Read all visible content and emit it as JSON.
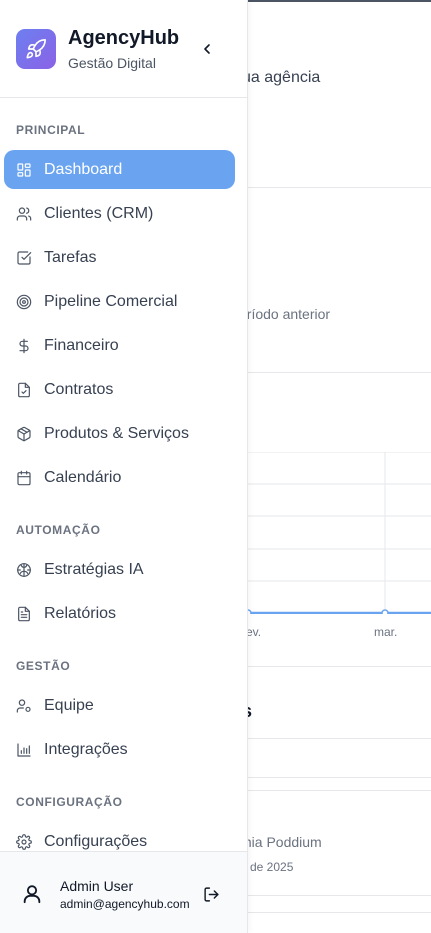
{
  "main": {
    "subtitle": "sua agência",
    "period_text": "eríodo anterior",
    "chart_ticks": [
      "ev.",
      "mar."
    ],
    "section_title": "s",
    "client_text": "mia Poddium",
    "date_text": "de 2025"
  },
  "sidebar": {
    "brand": {
      "name": "AgencyHub",
      "subtitle": "Gestão Digital"
    },
    "groups": [
      {
        "label": "PRINCIPAL"
      },
      {
        "label": "AUTOMAÇÃO"
      },
      {
        "label": "GESTÃO"
      },
      {
        "label": "CONFIGURAÇÃO"
      }
    ],
    "items": [
      {
        "label": "Dashboard",
        "icon": "dashboard-icon",
        "active": true
      },
      {
        "label": "Clientes (CRM)",
        "icon": "users-icon"
      },
      {
        "label": "Tarefas",
        "icon": "checkbox-icon"
      },
      {
        "label": "Pipeline Comercial",
        "icon": "target-icon"
      },
      {
        "label": "Financeiro",
        "icon": "dollar-icon"
      },
      {
        "label": "Contratos",
        "icon": "file-check-icon"
      },
      {
        "label": "Produtos & Serviços",
        "icon": "package-icon"
      },
      {
        "label": "Calendário",
        "icon": "calendar-icon"
      },
      {
        "label": "Estratégias IA",
        "icon": "brain-icon"
      },
      {
        "label": "Relatórios",
        "icon": "file-text-icon"
      },
      {
        "label": "Equipe",
        "icon": "user-cog-icon"
      },
      {
        "label": "Integrações",
        "icon": "bar-chart-icon"
      },
      {
        "label": "Configurações",
        "icon": "gear-icon"
      }
    ],
    "user": {
      "name": "Admin User",
      "email": "admin@agencyhub.com"
    }
  },
  "colors": {
    "accent": "#6aa4f0",
    "logo_start": "#6d7ff0",
    "logo_end": "#8a62e6"
  }
}
